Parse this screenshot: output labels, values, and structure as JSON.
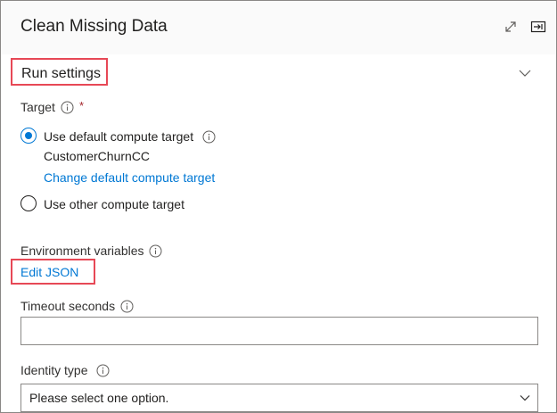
{
  "header": {
    "title": "Clean Missing Data",
    "expand_icon": "expand-diagonal-icon",
    "collapse_icon": "collapse-panel-icon"
  },
  "run_settings": {
    "title": "Run settings",
    "chevron_icon": "chevron-down-icon"
  },
  "target": {
    "label": "Target",
    "required_mark": "*",
    "options": [
      {
        "label": "Use default compute target",
        "selected": true
      },
      {
        "label": "Use other compute target",
        "selected": false
      }
    ],
    "default_compute": "CustomerChurnCC",
    "change_link": "Change default compute target"
  },
  "environment_variables": {
    "label": "Environment variables",
    "edit_link": "Edit JSON"
  },
  "timeout": {
    "label": "Timeout seconds",
    "value": "",
    "placeholder": ""
  },
  "identity_type": {
    "label": "Identity type",
    "selected": "Please select one option."
  },
  "colors": {
    "accent": "#0078d4",
    "highlight_box": "#e74856",
    "required": "#a4262c"
  }
}
